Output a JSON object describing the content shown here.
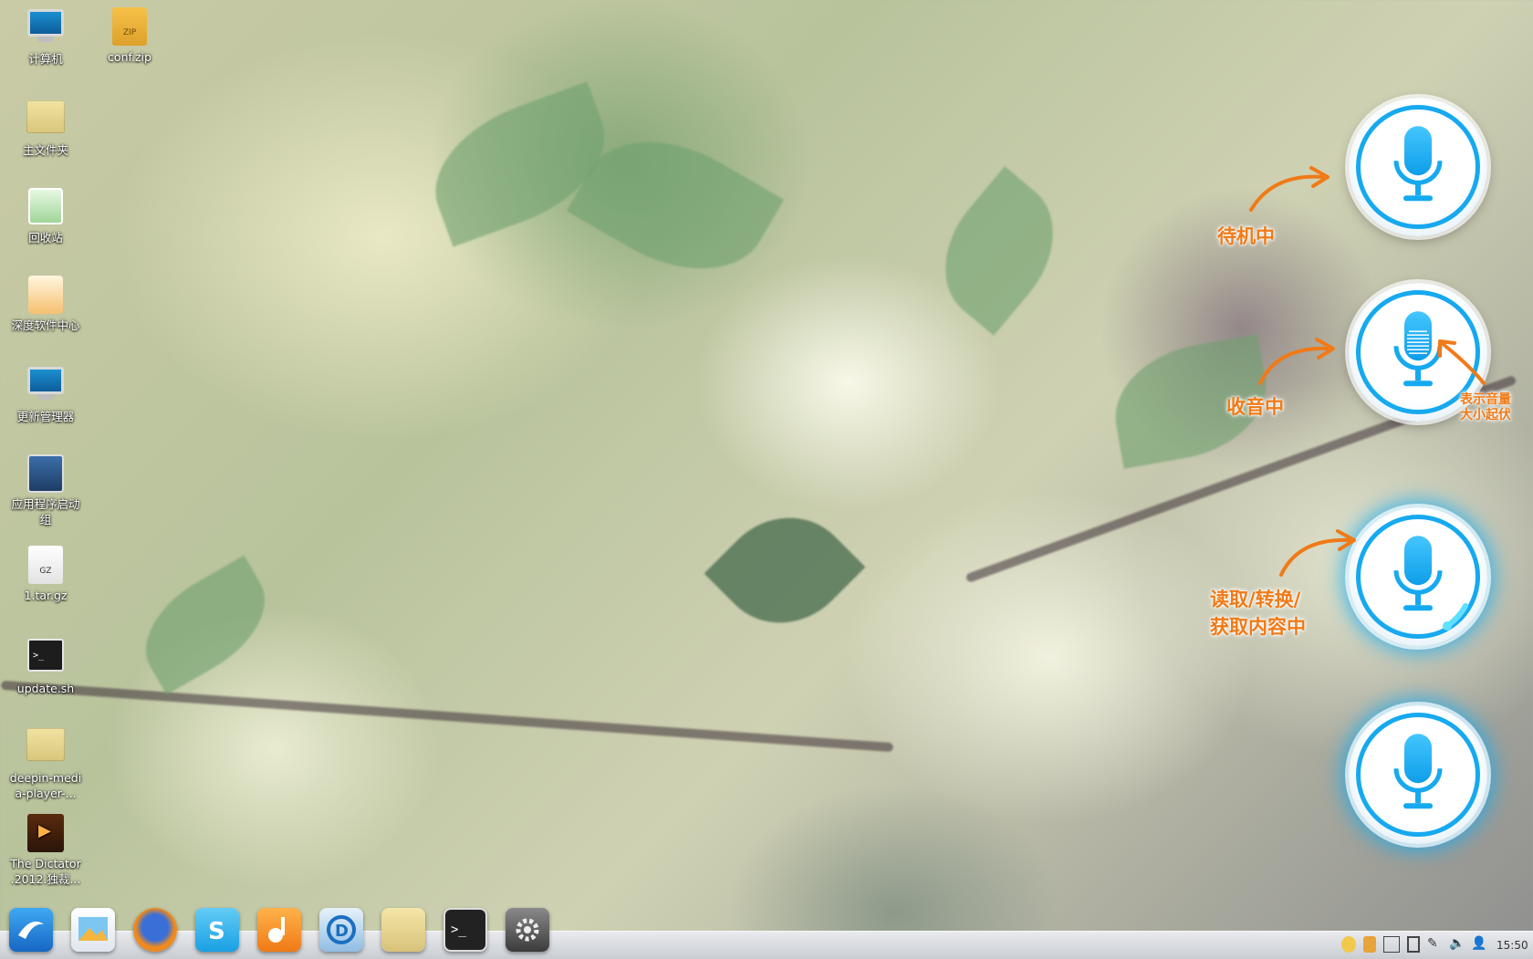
{
  "desktop_icons": [
    {
      "id": "computer",
      "label": "计算机",
      "icon": "computer-icon"
    },
    {
      "id": "conf-zip",
      "label": "conf.zip",
      "icon": "zip-archive-icon",
      "badge": "ZIP"
    },
    {
      "id": "home-folder",
      "label": "主文件夹",
      "icon": "home-folder-icon"
    },
    {
      "id": "trash",
      "label": "回收站",
      "icon": "trash-icon"
    },
    {
      "id": "software-center",
      "label": "深度软件中心",
      "icon": "software-center-icon"
    },
    {
      "id": "update-manager",
      "label": "更新管理器",
      "icon": "update-manager-icon"
    },
    {
      "id": "app-launcher-group",
      "label": "应用程序启动组",
      "icon": "app-launcher-icon"
    },
    {
      "id": "tar-gz",
      "label": "1.tar.gz",
      "icon": "gz-archive-icon",
      "badge": "GZ"
    },
    {
      "id": "update-sh",
      "label": "update.sh",
      "icon": "terminal-script-icon",
      "badge": ">_"
    },
    {
      "id": "deepin-media-player",
      "label": "deepin-media-player-...",
      "icon": "folder-icon"
    },
    {
      "id": "the-dictator",
      "label": "The Dictator .2012.独裁...",
      "icon": "video-file-icon"
    }
  ],
  "voice_states": {
    "standby": "待机中",
    "recording": "收音中",
    "volume_note_line1": "表示音量",
    "volume_note_line2": "大小起伏",
    "processing_line1": "读取/转换/",
    "processing_line2": "获取内容中"
  },
  "dock": {
    "items": [
      {
        "name": "deepin-start",
        "icon": "deepin-logo-icon"
      },
      {
        "name": "image-viewer",
        "icon": "image-viewer-icon"
      },
      {
        "name": "firefox",
        "icon": "firefox-icon"
      },
      {
        "name": "skype",
        "icon": "skype-icon"
      },
      {
        "name": "music-player",
        "icon": "music-player-icon"
      },
      {
        "name": "deepin-software",
        "icon": "software-store-icon"
      },
      {
        "name": "file-manager",
        "icon": "folder-icon"
      },
      {
        "name": "terminal",
        "icon": "terminal-icon"
      },
      {
        "name": "system-settings",
        "icon": "settings-icon"
      }
    ]
  },
  "tray": {
    "clock": "15:50",
    "icons": [
      "notification-icon",
      "power-icon",
      "keyboard-icon",
      "battery-icon",
      "pen-icon",
      "volume-icon",
      "user-icon"
    ]
  },
  "colors": {
    "accent_blue": "#16a9ef",
    "label_orange": "#f07a17"
  }
}
